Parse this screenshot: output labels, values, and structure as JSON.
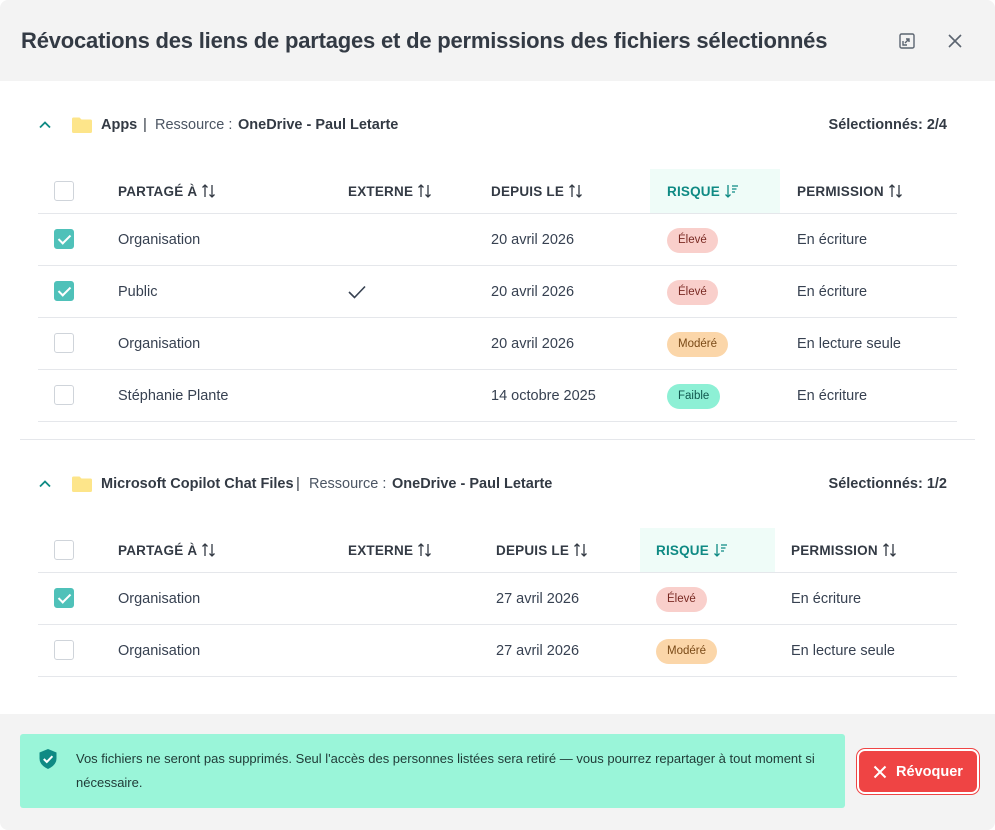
{
  "dialog": {
    "title": "Révocations des liens de partages et de permissions des fichiers sélectionnés",
    "expand_icon": "expand-icon",
    "close_icon": "close-icon"
  },
  "sections": [
    {
      "name": "Apps",
      "separator": "|",
      "resource_label": "Ressource :",
      "resource_value": "OneDrive - Paul Letarte",
      "selected_count": "Sélectionnés: 2/4",
      "columns": {
        "shared_to": "PARTAGÉ À",
        "external": "EXTERNE",
        "since": "DEPUIS LE",
        "risk": "RISQUE",
        "permission": "PERMISSION"
      },
      "rows": [
        {
          "checked": true,
          "shared_to": "Organisation",
          "external": false,
          "since": "20 avril 2026",
          "risk": "Élevé",
          "risk_level": "eleve",
          "permission": "En écriture"
        },
        {
          "checked": true,
          "shared_to": "Public",
          "external": true,
          "since": "20 avril 2026",
          "risk": "Élevé",
          "risk_level": "eleve",
          "permission": "En écriture"
        },
        {
          "checked": false,
          "shared_to": "Organisation",
          "external": false,
          "since": "20 avril 2026",
          "risk": "Modéré",
          "risk_level": "modere",
          "permission": "En lecture seule"
        },
        {
          "checked": false,
          "shared_to": "Stéphanie Plante",
          "external": false,
          "since": "14 octobre 2025",
          "risk": "Faible",
          "risk_level": "faible",
          "permission": "En écriture"
        }
      ]
    },
    {
      "name": "Microsoft Copilot Chat Files",
      "separator": "|",
      "resource_label": "Ressource :",
      "resource_value": "OneDrive - Paul Letarte",
      "selected_count": "Sélectionnés: 1/2",
      "columns": {
        "shared_to": "PARTAGÉ À",
        "external": "EXTERNE",
        "since": "DEPUIS LE",
        "risk": "RISQUE",
        "permission": "PERMISSION"
      },
      "rows": [
        {
          "checked": true,
          "shared_to": "Organisation",
          "external": false,
          "since": "27 avril 2026",
          "risk": "Élevé",
          "risk_level": "eleve",
          "permission": "En écriture"
        },
        {
          "checked": false,
          "shared_to": "Organisation",
          "external": false,
          "since": "27 avril 2026",
          "risk": "Modéré",
          "risk_level": "modere",
          "permission": "En lecture seule"
        }
      ]
    }
  ],
  "footer": {
    "notice": "Vos fichiers ne seront pas supprimés. Seul l'accès des personnes listées sera retiré — vous pourrez repartager à tout moment si nécessaire.",
    "notice_icon": "shield-check-icon",
    "revoke_label": "Révoquer"
  },
  "colors": {
    "accent": "#0f8a84",
    "checkbox": "#4fc1b9",
    "notice_bg": "#9af5d9",
    "danger": "#ef4444"
  }
}
